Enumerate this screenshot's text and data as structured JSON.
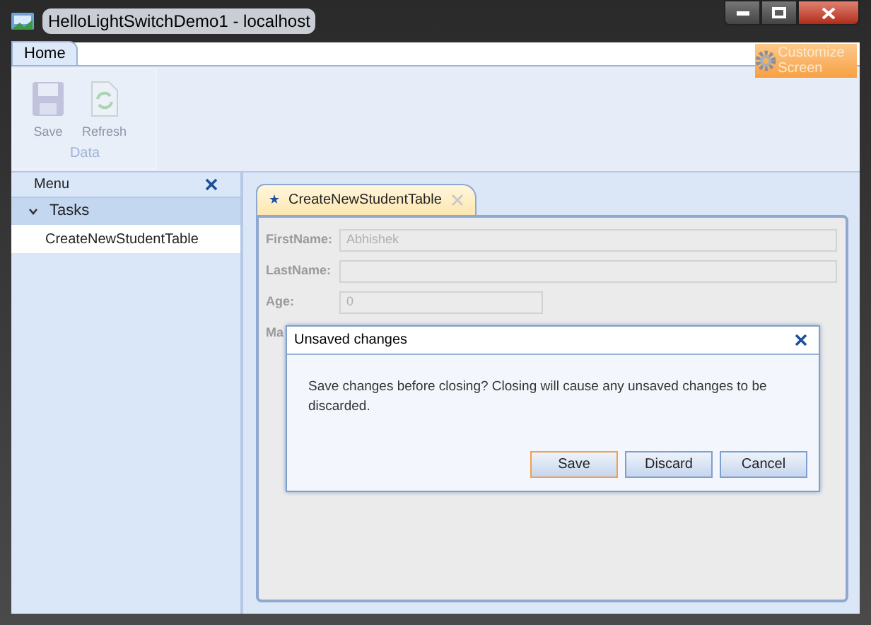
{
  "window": {
    "title": "HelloLightSwitchDemo1 - localhost"
  },
  "ribbon_tabs": [
    {
      "label": "Home",
      "selected": true
    }
  ],
  "customize_button": {
    "label": "Customize Screen"
  },
  "ribbon_group": {
    "label": "Data",
    "buttons": [
      {
        "label": "Save",
        "kind": "save",
        "disabled": true
      },
      {
        "label": "Refresh",
        "kind": "refresh",
        "disabled": true
      }
    ]
  },
  "menu": {
    "title": "Menu",
    "groups": [
      {
        "label": "Tasks",
        "expanded": true,
        "children": [
          {
            "label": "CreateNewStudentTable",
            "selected": true
          }
        ]
      }
    ]
  },
  "document_tab": {
    "label": "CreateNewStudentTable",
    "marker": "★"
  },
  "form": {
    "fields": [
      {
        "label": "FirstName:",
        "value": "Abhishek",
        "kind": "wide"
      },
      {
        "label": "LastName:",
        "kind": "wide"
      },
      {
        "label": "Age:",
        "value": "0",
        "kind": "narrow"
      },
      {
        "label": "Ma",
        "kind": "hidden"
      }
    ]
  },
  "dialog": {
    "title": "Unsaved changes",
    "message": "Save changes before closing? Closing will cause any unsaved changes to be discarded.",
    "buttons": [
      {
        "label": "Save",
        "focused": true
      },
      {
        "label": "Discard",
        "focused": false
      },
      {
        "label": "Cancel",
        "focused": false
      }
    ]
  }
}
